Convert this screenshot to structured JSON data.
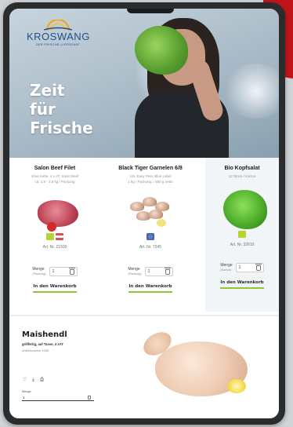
{
  "brand": {
    "name": "KROSWANG",
    "tagline": "DER FRISCHE-LIEFERANT"
  },
  "hero": {
    "title_line1": "Zeit",
    "title_line2": "für",
    "title_line3": "Frische"
  },
  "products": [
    {
      "name": "Salon Beef Filet",
      "sub_line1": "ohne Kette, 4 x AT, Salon Beef",
      "sub_line2": "ca. 1,8 - 2,8 kg / Packung",
      "flags": [
        "#b8d433",
        "#e04a5a"
      ],
      "art_nr": "Art. Nr. 21500",
      "qty_label": "Menge",
      "qty_unit": "(Packung)",
      "qty_value": "1",
      "cart_label": "In den Warenkorb"
    },
    {
      "name": "Black Tiger Garnelen 6/8",
      "sub_line1": "roh, Easy Peel, Blue Label",
      "sub_line2": "1 kg / Packung = 800 g netto",
      "flags": [
        "#3a5fb0"
      ],
      "art_nr": "Art. Nr. 7245",
      "qty_label": "Menge",
      "qty_unit": "(Packung)",
      "qty_value": "1",
      "cart_label": "In den Warenkorb"
    },
    {
      "name": "Bio Kopfsalat",
      "sub_line1": "12 Stück / Karton",
      "sub_line2": "",
      "flags": [
        "#b8d433"
      ],
      "art_nr": "Art. Nr. 32610",
      "qty_label": "Menge",
      "qty_unit": "(Karton)",
      "qty_value": "1",
      "cart_label": "In den Warenkorb"
    }
  ],
  "featured": {
    "title": "Maishendl",
    "subtitle": "grillfertig, auf Tasse, 4 xAT",
    "art_nr": "Artikelnummer 1005",
    "icons": [
      "heart-icon",
      "download-icon",
      "print-icon"
    ],
    "qty_label": "Menge",
    "qty_value": "1"
  },
  "colors": {
    "accent_green": "#8fc63a",
    "brand_blue": "#1e4f8c",
    "brand_red": "#c0141b"
  }
}
